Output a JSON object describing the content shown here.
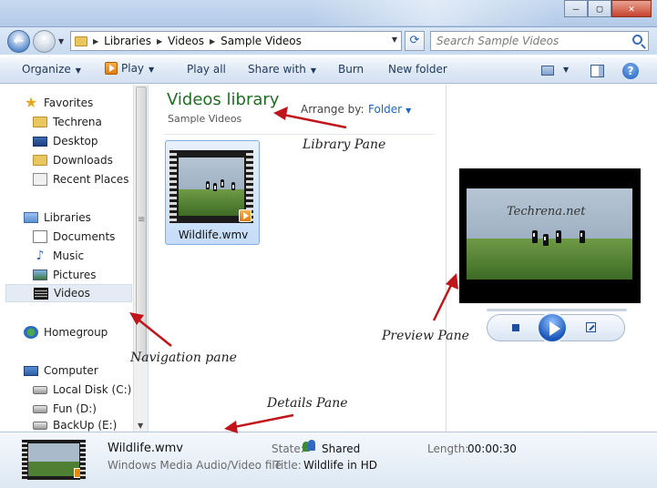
{
  "window": {
    "buttons": {
      "minimize": "—",
      "maximize": "▢",
      "close": "✕"
    }
  },
  "address": {
    "breadcrumbs": [
      "Libraries",
      "Videos",
      "Sample Videos"
    ],
    "search_placeholder": "Search Sample Videos"
  },
  "toolbar": {
    "organize": "Organize",
    "play": "Play",
    "play_all": "Play all",
    "share_with": "Share with",
    "burn": "Burn",
    "new_folder": "New folder",
    "help": "?"
  },
  "nav": {
    "favorites": "Favorites",
    "favorites_items": [
      "Techrena",
      "Desktop",
      "Downloads",
      "Recent Places"
    ],
    "libraries": "Libraries",
    "libraries_items": [
      "Documents",
      "Music",
      "Pictures",
      "Videos"
    ],
    "homegroup": "Homegroup",
    "computer": "Computer",
    "computer_items": [
      "Local Disk (C:)",
      "Fun (D:)",
      "BackUp (E:)"
    ],
    "selected": "Videos"
  },
  "library": {
    "title": "Videos library",
    "subtitle": "Sample Videos",
    "arrange_label": "Arrange by:",
    "arrange_value": "Folder",
    "file_name": "Wildlife.wmv"
  },
  "preview": {
    "watermark": "Techrena.net"
  },
  "details": {
    "name": "Wildlife.wmv",
    "type": "Windows Media Audio/Video file",
    "state_label": "State:",
    "state_value": "Shared",
    "length_label": "Length:",
    "length_value": "00:00:30",
    "title_label": "Title:",
    "title_value": "Wildlife in HD"
  },
  "annotations": {
    "library_pane": "Library Pane",
    "navigation_pane": "Navigation pane",
    "preview_pane": "Preview Pane",
    "details_pane": "Details Pane"
  },
  "colors": {
    "library_title": "#1e6e23",
    "arrange_link": "#1e64c8",
    "annotation_arrow": "#c0151a"
  }
}
